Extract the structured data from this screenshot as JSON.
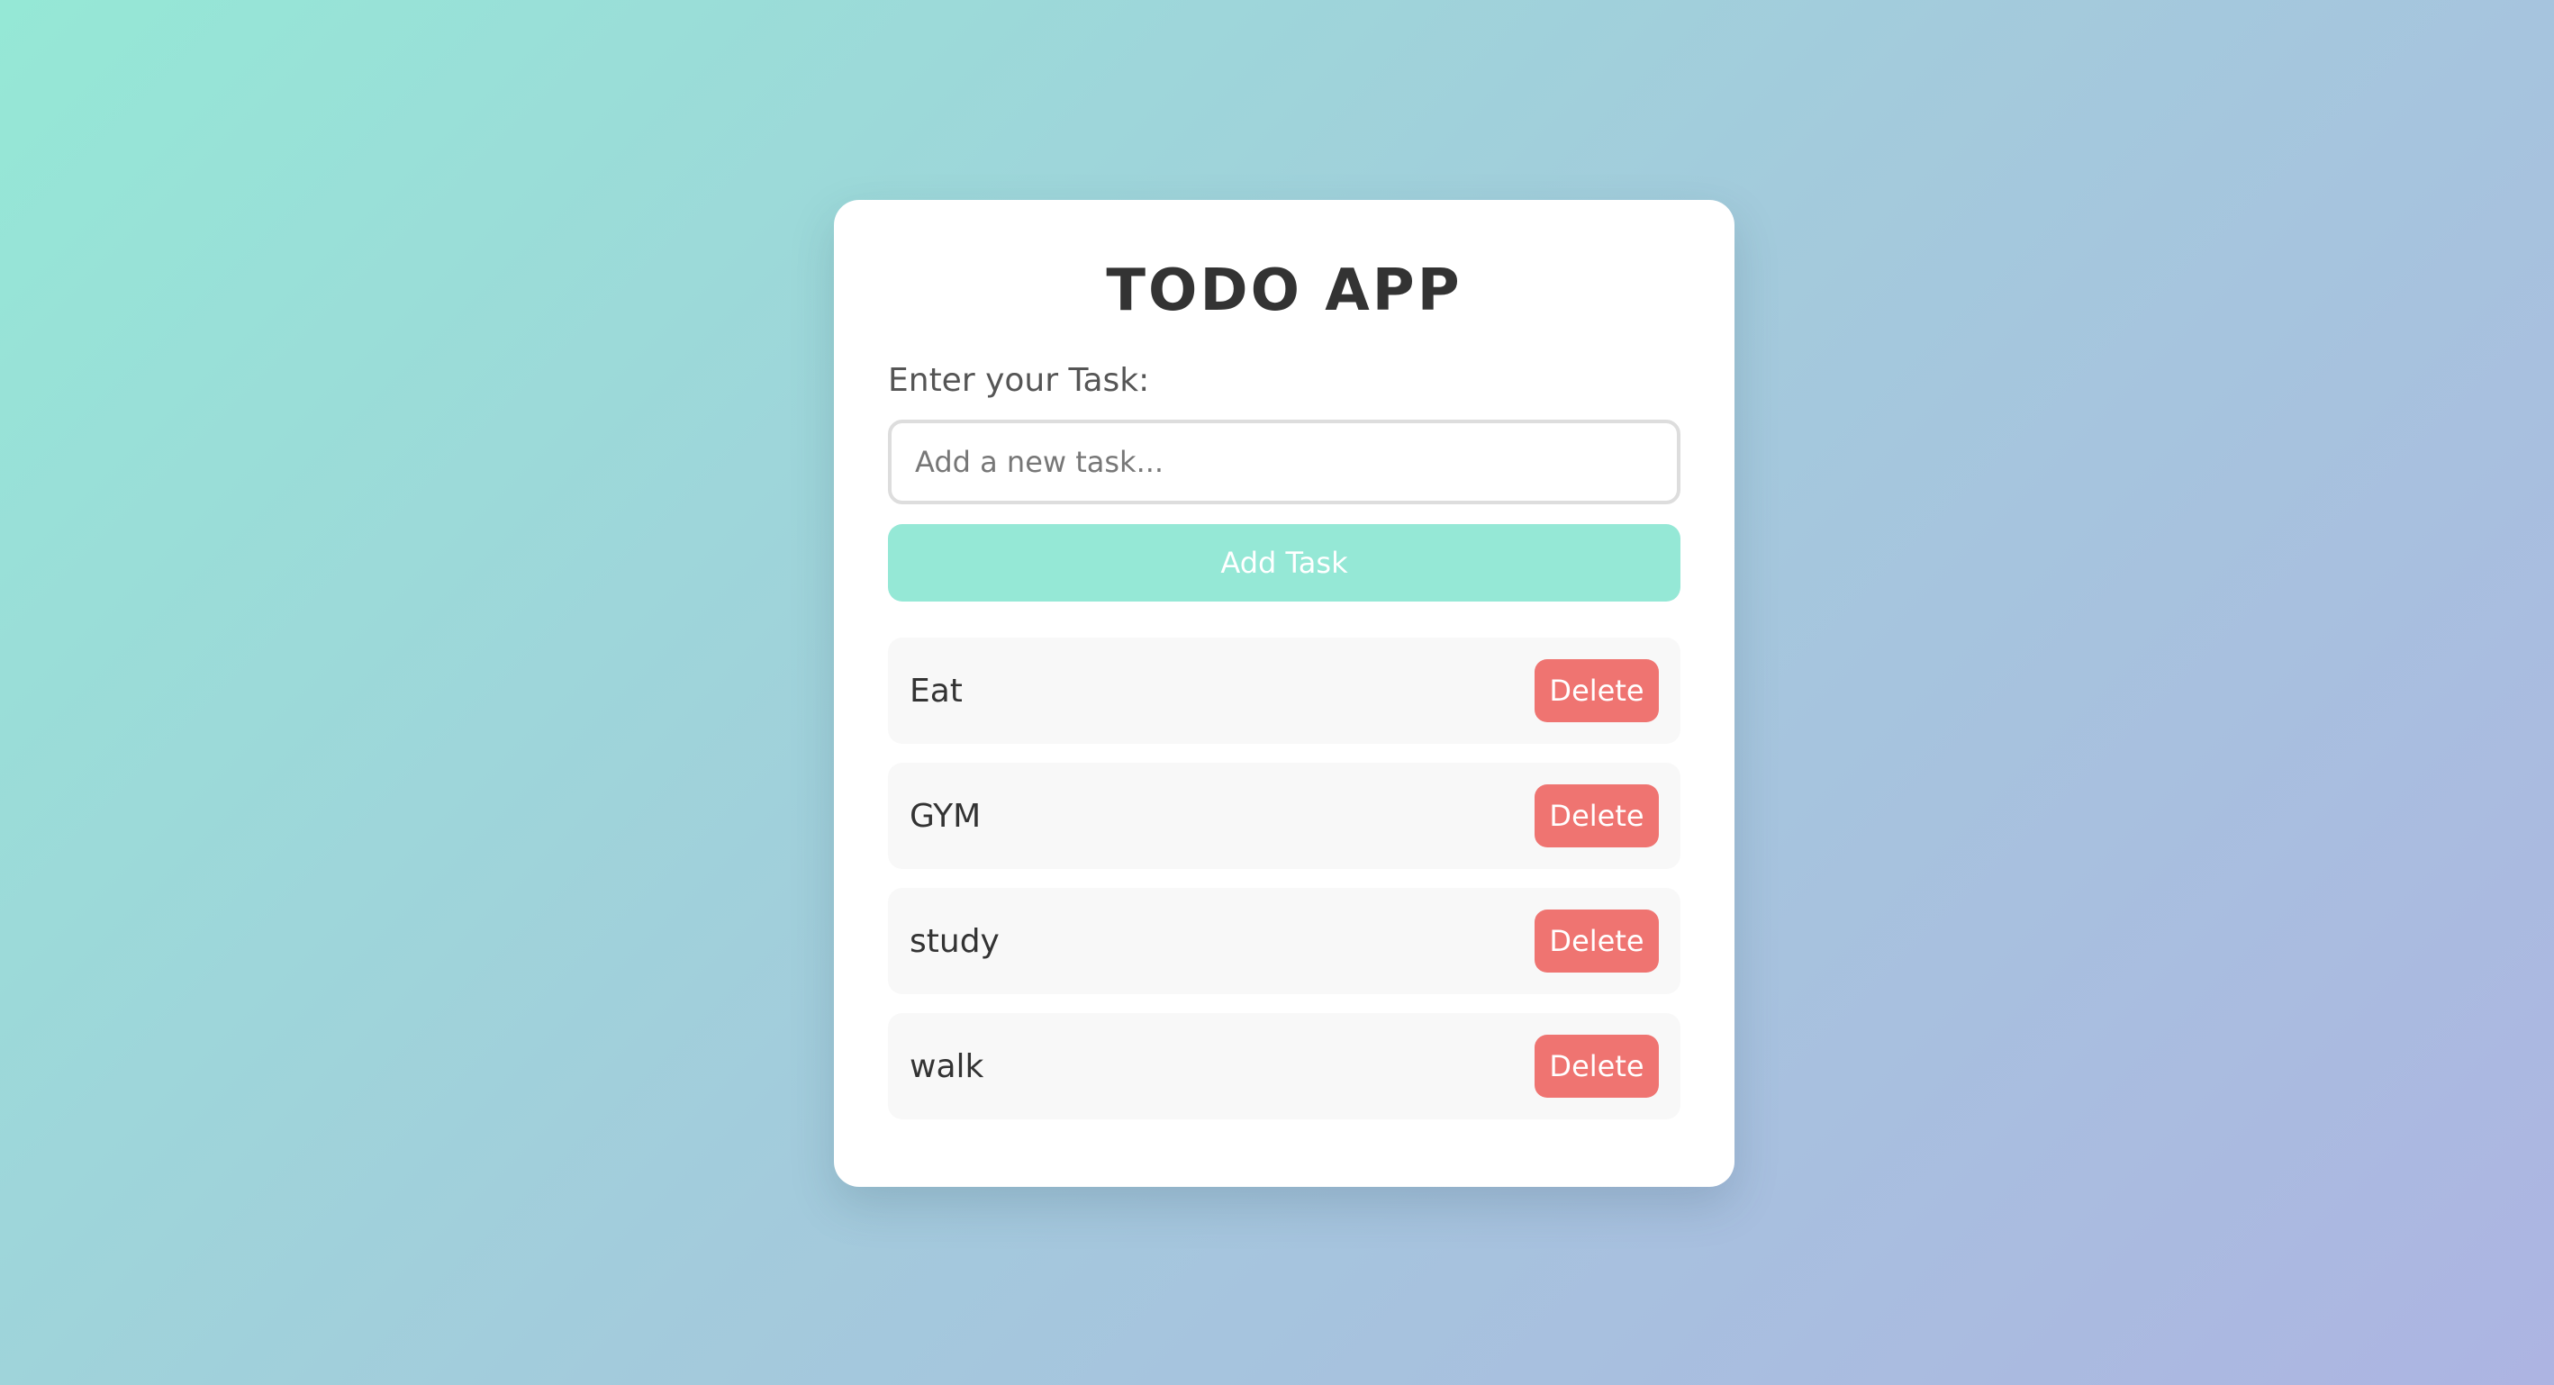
{
  "app": {
    "title": "TODO APP"
  },
  "form": {
    "label": "Enter your Task:",
    "input_value": "",
    "input_placeholder": "Add a new task...",
    "add_button_label": "Add Task"
  },
  "tasks": [
    {
      "text": "Eat",
      "delete_label": "Delete"
    },
    {
      "text": "GYM",
      "delete_label": "Delete"
    },
    {
      "text": "study",
      "delete_label": "Delete"
    },
    {
      "text": "walk",
      "delete_label": "Delete"
    }
  ],
  "colors": {
    "background_start": "#95e8d6",
    "background_end": "#adb4e2",
    "card": "#ffffff",
    "add_button": "#95e8d6",
    "delete_button": "#ef7471",
    "task_background": "#f8f8f8",
    "title_text": "#333333"
  }
}
